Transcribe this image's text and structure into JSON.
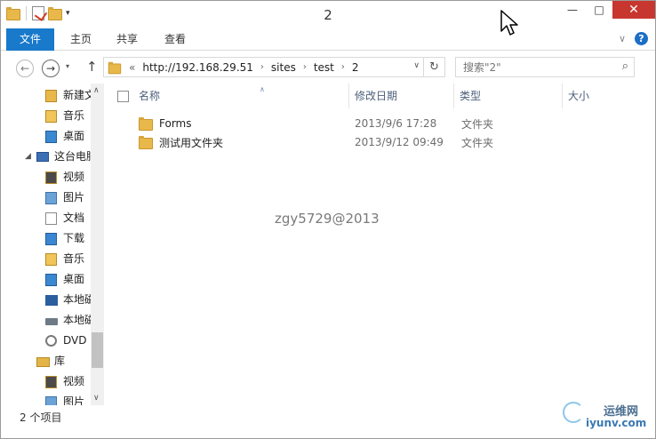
{
  "window": {
    "title": "2",
    "minimize_glyph": "—",
    "maximize_glyph": "□",
    "close_glyph": "✕"
  },
  "ribbon": {
    "tabs": [
      {
        "label": "文件"
      },
      {
        "label": "主页"
      },
      {
        "label": "共享"
      },
      {
        "label": "查看"
      }
    ],
    "collapse_glyph": "∨",
    "help_glyph": "?"
  },
  "nav": {
    "back_glyph": "←",
    "forward_glyph": "→",
    "recent_glyph": "▾",
    "up_glyph": "↑",
    "overflow": "«",
    "breadcrumb": [
      {
        "label": "http://192.168.29.51"
      },
      {
        "label": "sites"
      },
      {
        "label": "test"
      },
      {
        "label": "2"
      }
    ],
    "breadcrumb_sep": "›",
    "dropdown_glyph": "∨",
    "refresh_glyph": "↻"
  },
  "search": {
    "placeholder": "搜索\"2\"",
    "glyph": "⌕"
  },
  "sidebar": {
    "items": [
      {
        "label": "新建文",
        "icon": "folder-icon"
      },
      {
        "label": "音乐",
        "icon": "music-icon"
      },
      {
        "label": "桌面",
        "icon": "desktop-icon"
      },
      {
        "label": "这台电脑",
        "icon": "pc-icon"
      },
      {
        "label": "视频",
        "icon": "video-icon"
      },
      {
        "label": "图片",
        "icon": "picture-icon"
      },
      {
        "label": "文档",
        "icon": "document-icon"
      },
      {
        "label": "下载",
        "icon": "download-icon"
      },
      {
        "label": "音乐",
        "icon": "music-icon"
      },
      {
        "label": "桌面",
        "icon": "desktop-icon"
      },
      {
        "label": "本地磁",
        "icon": "drive-icon"
      },
      {
        "label": "本地磁",
        "icon": "drive-icon"
      },
      {
        "label": "DVD",
        "icon": "dvd-icon"
      },
      {
        "label": "库",
        "icon": "library-icon"
      },
      {
        "label": "视频",
        "icon": "video-icon"
      },
      {
        "label": "图片",
        "icon": "picture-icon"
      }
    ],
    "pc_expander": "◢",
    "scroll_up": "∧",
    "scroll_down": "∨"
  },
  "columns": {
    "name": "名称",
    "date": "修改日期",
    "type": "类型",
    "size": "大小",
    "sort_glyph": "∧"
  },
  "files": [
    {
      "name": "Forms",
      "date": "2013/9/6 17:28",
      "type": "文件夹"
    },
    {
      "name": "测试用文件夹",
      "date": "2013/9/12 09:49",
      "type": "文件夹"
    }
  ],
  "watermark": "zgy5729@2013",
  "status": {
    "count": "2 个项目"
  },
  "site_logo": {
    "line1": "运维网",
    "line2": "iyunv.com"
  },
  "colors": {
    "file_tab": "#1979ca",
    "close_button": "#c7372f",
    "folder": "#e8b94a"
  }
}
